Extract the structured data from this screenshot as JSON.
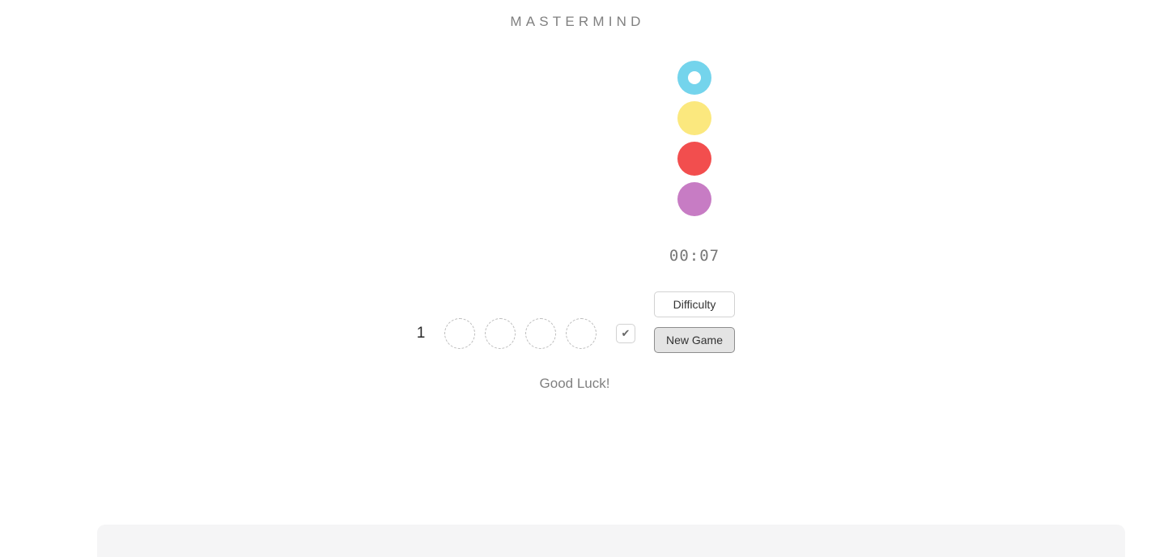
{
  "app": {
    "title": "MASTERMIND"
  },
  "palette": {
    "pegs": [
      {
        "name": "cyan",
        "color": "#74d4ec",
        "selected": true
      },
      {
        "name": "yellow",
        "color": "#fbe87e",
        "selected": false
      },
      {
        "name": "red",
        "color": "#f24e4e",
        "selected": false
      },
      {
        "name": "purple",
        "color": "#c77cc4",
        "selected": false
      }
    ]
  },
  "timer": {
    "value": "00:07"
  },
  "controls": {
    "difficulty_label": "Difficulty",
    "new_game_label": "New Game"
  },
  "board": {
    "row_number": "1",
    "slots": [
      "",
      "",
      "",
      ""
    ],
    "submit_icon": "✔"
  },
  "status": {
    "message": "Good Luck!"
  }
}
